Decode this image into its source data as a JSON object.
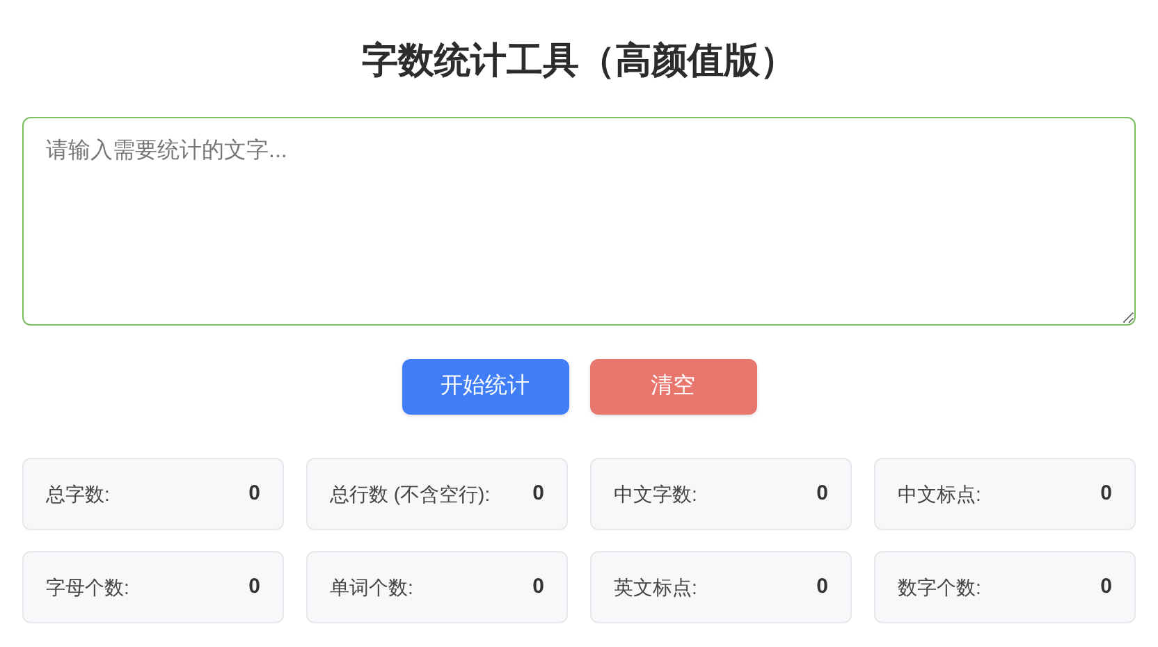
{
  "title": "字数统计工具（高颜值版）",
  "input": {
    "placeholder": "请输入需要统计的文字..."
  },
  "buttons": [
    {
      "kind": "primary",
      "label": "开始统计"
    },
    {
      "kind": "danger",
      "label": "清空"
    }
  ],
  "stats": [
    {
      "label": "总字数:",
      "value": "0"
    },
    {
      "label": "总行数 (不含空行):",
      "value": "0"
    },
    {
      "label": "中文字数:",
      "value": "0"
    },
    {
      "label": "中文标点:",
      "value": "0"
    },
    {
      "label": "字母个数:",
      "value": "0"
    },
    {
      "label": "单词个数:",
      "value": "0"
    },
    {
      "label": "英文标点:",
      "value": "0"
    },
    {
      "label": "数字个数:",
      "value": "0"
    }
  ]
}
